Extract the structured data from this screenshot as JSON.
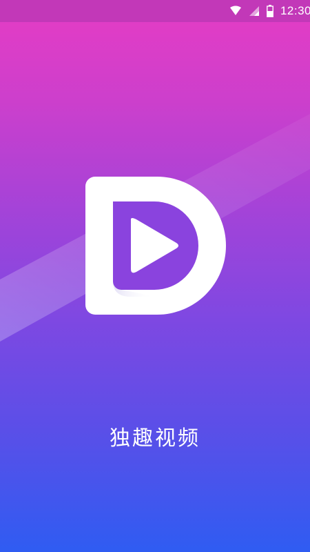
{
  "status_bar": {
    "time": "12:30",
    "icons": [
      "wifi-icon",
      "signal-icon",
      "battery-icon"
    ]
  },
  "splash": {
    "app_name": "独趣视频",
    "logo_icon": "play-d-logo-icon"
  },
  "colors": {
    "gradient_top": "#e63cc4",
    "gradient_bottom": "#2f5cf2",
    "logo_fill": "#ffffff",
    "play_fill": "#8a3fe0"
  }
}
